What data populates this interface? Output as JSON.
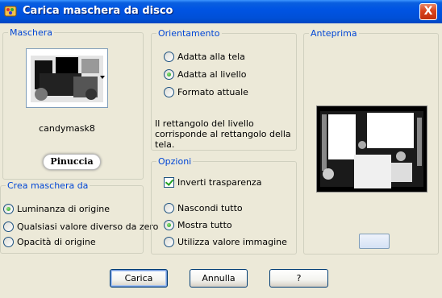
{
  "window": {
    "title": "Carica maschera da disco",
    "close_symbol": "X",
    "icons": {
      "app": "paintshop-icon",
      "close": "close-icon"
    }
  },
  "maschera": {
    "legend": "Maschera",
    "mask_name": "candymask8",
    "logo_text": "Pinuccia"
  },
  "orientamento": {
    "legend": "Orientamento",
    "options": [
      {
        "label": "Adatta alla tela",
        "checked": false
      },
      {
        "label": "Adatta al livello",
        "checked": true
      },
      {
        "label": "Formato attuale",
        "checked": false
      }
    ],
    "description": "Il rettangolo del livello corrisponde al rettangolo della tela."
  },
  "opzioni": {
    "legend": "Opzioni",
    "invert_label": "Inverti trasparenza",
    "invert_checked": true,
    "options": [
      {
        "label": "Nascondi tutto",
        "checked": false
      },
      {
        "label": "Mostra tutto",
        "checked": true
      },
      {
        "label": "Utilizza valore immagine",
        "checked": false
      }
    ]
  },
  "crea": {
    "legend": "Crea maschera da",
    "options": [
      {
        "label": "Luminanza di origine",
        "checked": true
      },
      {
        "label": "Qualsiasi valore diverso da zero",
        "checked": false
      },
      {
        "label": "Opacità di origine",
        "checked": false
      }
    ]
  },
  "anteprima": {
    "legend": "Anteprima"
  },
  "buttons": {
    "load": "Carica",
    "cancel": "Annulla",
    "help": "?"
  },
  "colors": {
    "title_blue": "#0054e3",
    "legend_blue": "#0046d5",
    "dialog_bg": "#ece9d8",
    "close_red": "#d9431c"
  }
}
